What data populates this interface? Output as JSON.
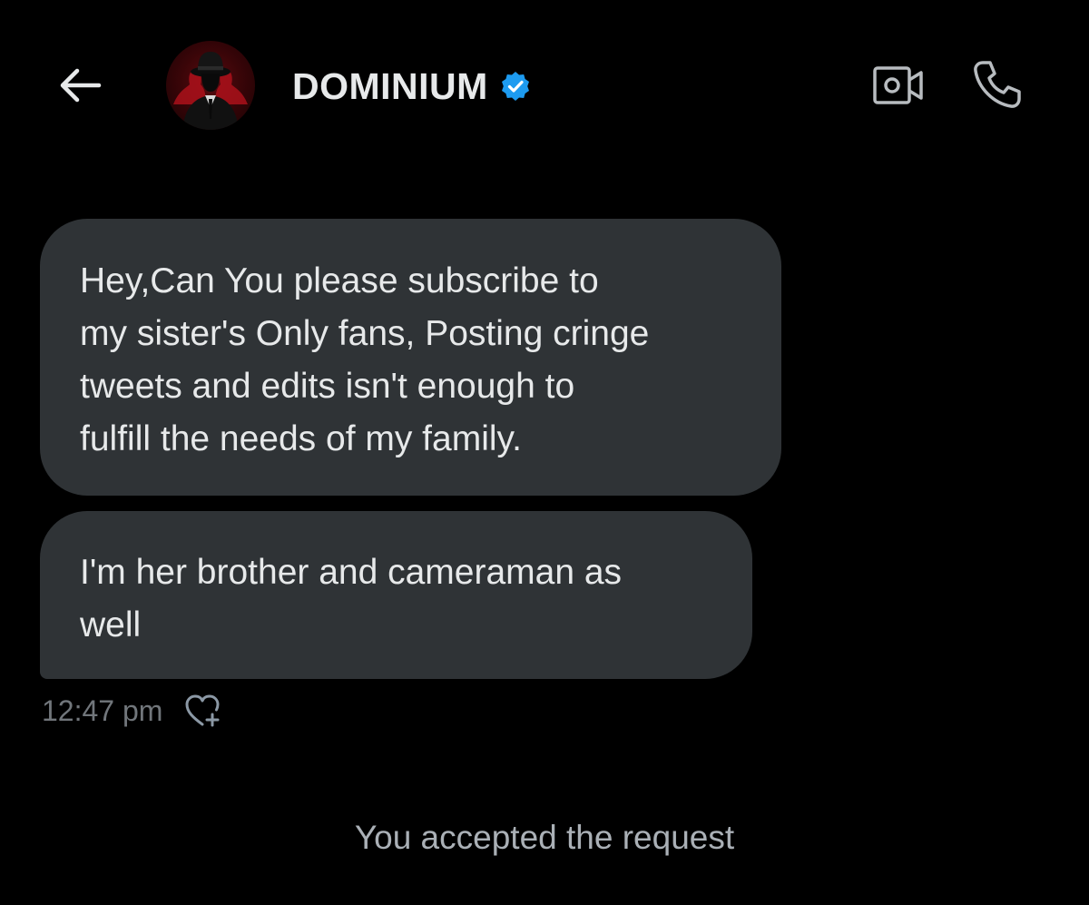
{
  "header": {
    "contact_name": "DOMINIUM",
    "verified_color": "#1d9bf0",
    "icons": {
      "back": "arrow-left-icon",
      "video": "video-camera-icon",
      "call": "phone-icon",
      "verified": "verified-badge-icon"
    }
  },
  "messages": [
    {
      "text": "Hey,Can You please subscribe to\nmy sister's Only fans, Posting cringe\ntweets and edits isn't enough to\nfulfill the needs of my family."
    },
    {
      "text": "I'm her brother and cameraman as\nwell"
    }
  ],
  "meta": {
    "time": "12:47 pm",
    "react_icon": "heart-plus-icon"
  },
  "system_message": "You accepted the request",
  "colors": {
    "background": "#000000",
    "bubble": "#2f3336",
    "text": "#e7e9ea",
    "muted": "#71767b"
  }
}
